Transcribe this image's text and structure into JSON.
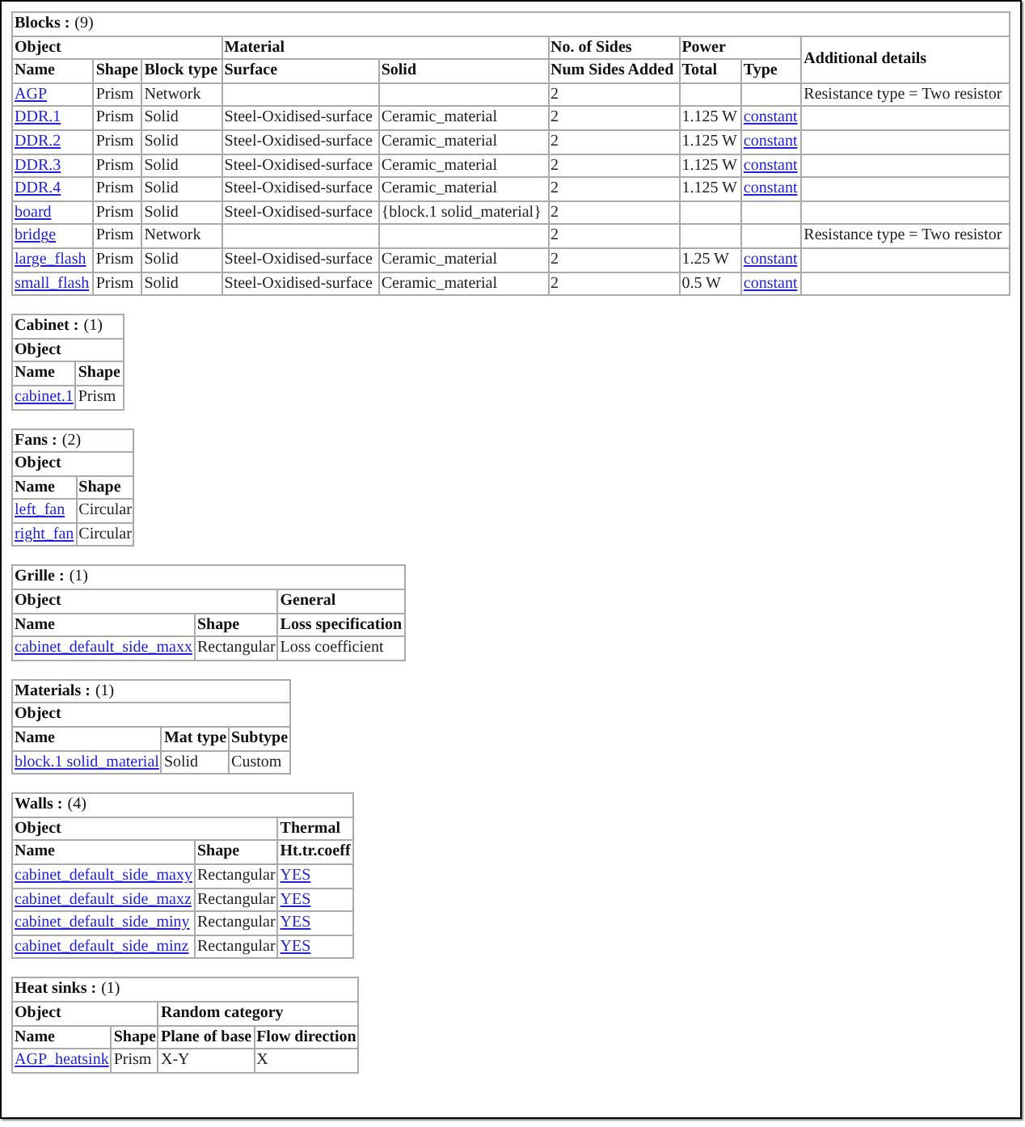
{
  "sections": [
    {
      "title": "Blocks :",
      "count": "(9)",
      "groups": [
        {
          "label": "Object",
          "columns": [
            "Name",
            "Shape",
            "Block type"
          ]
        },
        {
          "label": "Material",
          "columns": [
            "Surface",
            "Solid"
          ]
        },
        {
          "label": "No. of Sides",
          "columns": [
            "Num Sides Added"
          ]
        },
        {
          "label": "Power",
          "columns": [
            "Total",
            "Type"
          ]
        },
        {
          "label": "Additional details"
        }
      ],
      "rows": [
        [
          {
            "text": "AGP",
            "link": true
          },
          {
            "text": "Prism"
          },
          {
            "text": "Network"
          },
          null,
          null,
          {
            "text": "2"
          },
          null,
          null,
          {
            "text": "Resistance type = Two resistor"
          }
        ],
        [
          {
            "text": "DDR.1",
            "link": true
          },
          {
            "text": "Prism"
          },
          {
            "text": "Solid"
          },
          {
            "text": "Steel-Oxidised-surface"
          },
          {
            "text": "Ceramic_material"
          },
          {
            "text": "2"
          },
          {
            "text": "1.125 W"
          },
          {
            "text": "constant",
            "link": true
          },
          null
        ],
        [
          {
            "text": "DDR.2",
            "link": true
          },
          {
            "text": "Prism"
          },
          {
            "text": "Solid"
          },
          {
            "text": "Steel-Oxidised-surface"
          },
          {
            "text": "Ceramic_material"
          },
          {
            "text": "2"
          },
          {
            "text": "1.125 W"
          },
          {
            "text": "constant",
            "link": true
          },
          null
        ],
        [
          {
            "text": "DDR.3",
            "link": true
          },
          {
            "text": "Prism"
          },
          {
            "text": "Solid"
          },
          {
            "text": "Steel-Oxidised-surface"
          },
          {
            "text": "Ceramic_material"
          },
          {
            "text": "2"
          },
          {
            "text": "1.125 W"
          },
          {
            "text": "constant",
            "link": true
          },
          null
        ],
        [
          {
            "text": "DDR.4",
            "link": true
          },
          {
            "text": "Prism"
          },
          {
            "text": "Solid"
          },
          {
            "text": "Steel-Oxidised-surface"
          },
          {
            "text": "Ceramic_material"
          },
          {
            "text": "2"
          },
          {
            "text": "1.125 W"
          },
          {
            "text": "constant",
            "link": true
          },
          null
        ],
        [
          {
            "text": "board",
            "link": true
          },
          {
            "text": "Prism"
          },
          {
            "text": "Solid"
          },
          {
            "text": "Steel-Oxidised-surface"
          },
          {
            "text": "{block.1 solid_material}"
          },
          {
            "text": "2"
          },
          null,
          null,
          null
        ],
        [
          {
            "text": "bridge",
            "link": true
          },
          {
            "text": "Prism"
          },
          {
            "text": "Network"
          },
          null,
          null,
          {
            "text": "2"
          },
          null,
          null,
          {
            "text": "Resistance type = Two resistor"
          }
        ],
        [
          {
            "text": "large_flash",
            "link": true
          },
          {
            "text": "Prism"
          },
          {
            "text": "Solid"
          },
          {
            "text": "Steel-Oxidised-surface"
          },
          {
            "text": "Ceramic_material"
          },
          {
            "text": "2"
          },
          {
            "text": "1.25 W"
          },
          {
            "text": "constant",
            "link": true
          },
          null
        ],
        [
          {
            "text": "small_flash",
            "link": true
          },
          {
            "text": "Prism"
          },
          {
            "text": "Solid"
          },
          {
            "text": "Steel-Oxidised-surface"
          },
          {
            "text": "Ceramic_material"
          },
          {
            "text": "2"
          },
          {
            "text": "0.5 W"
          },
          {
            "text": "constant",
            "link": true
          },
          null
        ]
      ]
    },
    {
      "title": "Cabinet :",
      "count": "(1)",
      "groups": [
        {
          "label": "Object",
          "columns": [
            "Name",
            "Shape"
          ]
        }
      ],
      "rows": [
        [
          {
            "text": "cabinet.1",
            "link": true
          },
          {
            "text": "Prism"
          }
        ]
      ]
    },
    {
      "title": "Fans :",
      "count": "(2)",
      "groups": [
        {
          "label": "Object",
          "columns": [
            "Name",
            "Shape"
          ]
        }
      ],
      "rows": [
        [
          {
            "text": "left_fan",
            "link": true
          },
          {
            "text": "Circular"
          }
        ],
        [
          {
            "text": "right_fan",
            "link": true
          },
          {
            "text": "Circular"
          }
        ]
      ]
    },
    {
      "title": "Grille :",
      "count": "(1)",
      "groups": [
        {
          "label": "Object",
          "columns": [
            "Name",
            "Shape"
          ]
        },
        {
          "label": "General",
          "columns": [
            "Loss specification"
          ]
        }
      ],
      "rows": [
        [
          {
            "text": "cabinet_default_side_maxx",
            "link": true
          },
          {
            "text": "Rectangular"
          },
          {
            "text": "Loss coefficient"
          }
        ]
      ]
    },
    {
      "title": "Materials :",
      "count": "(1)",
      "groups": [
        {
          "label": "Object",
          "columns": [
            "Name",
            "Mat type",
            "Subtype"
          ]
        }
      ],
      "rows": [
        [
          {
            "text": "block.1 solid_material",
            "link": true
          },
          {
            "text": "Solid"
          },
          {
            "text": "Custom"
          }
        ]
      ]
    },
    {
      "title": "Walls :",
      "count": "(4)",
      "groups": [
        {
          "label": "Object",
          "columns": [
            "Name",
            "Shape"
          ]
        },
        {
          "label": "Thermal",
          "columns": [
            "Ht.tr.coeff"
          ]
        }
      ],
      "rows": [
        [
          {
            "text": "cabinet_default_side_maxy",
            "link": true
          },
          {
            "text": "Rectangular"
          },
          {
            "text": "YES",
            "link": true
          }
        ],
        [
          {
            "text": "cabinet_default_side_maxz",
            "link": true
          },
          {
            "text": "Rectangular"
          },
          {
            "text": "YES",
            "link": true
          }
        ],
        [
          {
            "text": "cabinet_default_side_miny",
            "link": true
          },
          {
            "text": "Rectangular"
          },
          {
            "text": "YES",
            "link": true
          }
        ],
        [
          {
            "text": "cabinet_default_side_minz",
            "link": true
          },
          {
            "text": "Rectangular"
          },
          {
            "text": "YES",
            "link": true
          }
        ]
      ]
    },
    {
      "title": "Heat sinks :",
      "count": "(1)",
      "groups": [
        {
          "label": "Object",
          "columns": [
            "Name",
            "Shape"
          ]
        },
        {
          "label": "Random category",
          "columns": [
            "Plane of base",
            "Flow direction"
          ]
        }
      ],
      "rows": [
        [
          {
            "text": "AGP_heatsink",
            "link": true
          },
          {
            "text": "Prism"
          },
          {
            "text": "X-Y"
          },
          {
            "text": "X"
          }
        ]
      ]
    }
  ]
}
